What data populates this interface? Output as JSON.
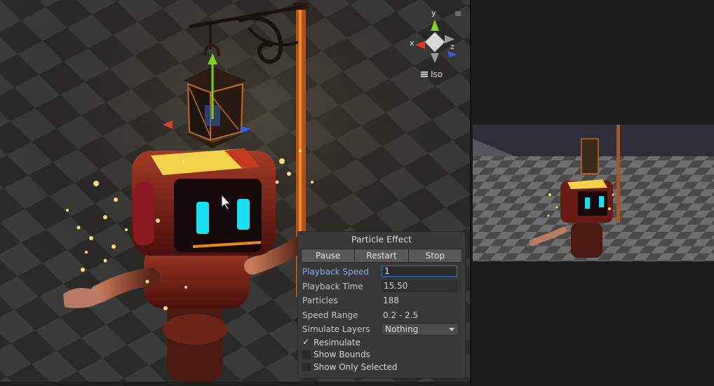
{
  "scene": {
    "gizmo": {
      "x_label": "x",
      "y_label": "y",
      "z_label": "z",
      "projection_label": "Iso"
    }
  },
  "particle_effect": {
    "title": "Particle Effect",
    "buttons": {
      "pause": "Pause",
      "restart": "Restart",
      "stop": "Stop"
    },
    "rows": {
      "playback_speed": {
        "label": "Playback Speed",
        "value": "1"
      },
      "playback_time": {
        "label": "Playback Time",
        "value": "15.50"
      },
      "particles": {
        "label": "Particles",
        "value": "188"
      },
      "speed_range": {
        "label": "Speed Range",
        "value": "0.2 - 2.5"
      },
      "simulate_layers": {
        "label": "Simulate Layers",
        "value": "Nothing"
      }
    },
    "checkboxes": {
      "resimulate": {
        "label": "Resimulate",
        "checked": true
      },
      "show_bounds": {
        "label": "Show Bounds",
        "checked": false
      },
      "show_only_selected": {
        "label": "Show Only Selected",
        "checked": false
      }
    }
  },
  "colors": {
    "accent_blue": "#3a79c9",
    "robot_body": "#7a1c14",
    "robot_face": "#19e0f0",
    "lamp_post": "#c85a14",
    "star_particles": "#f5e07a"
  }
}
